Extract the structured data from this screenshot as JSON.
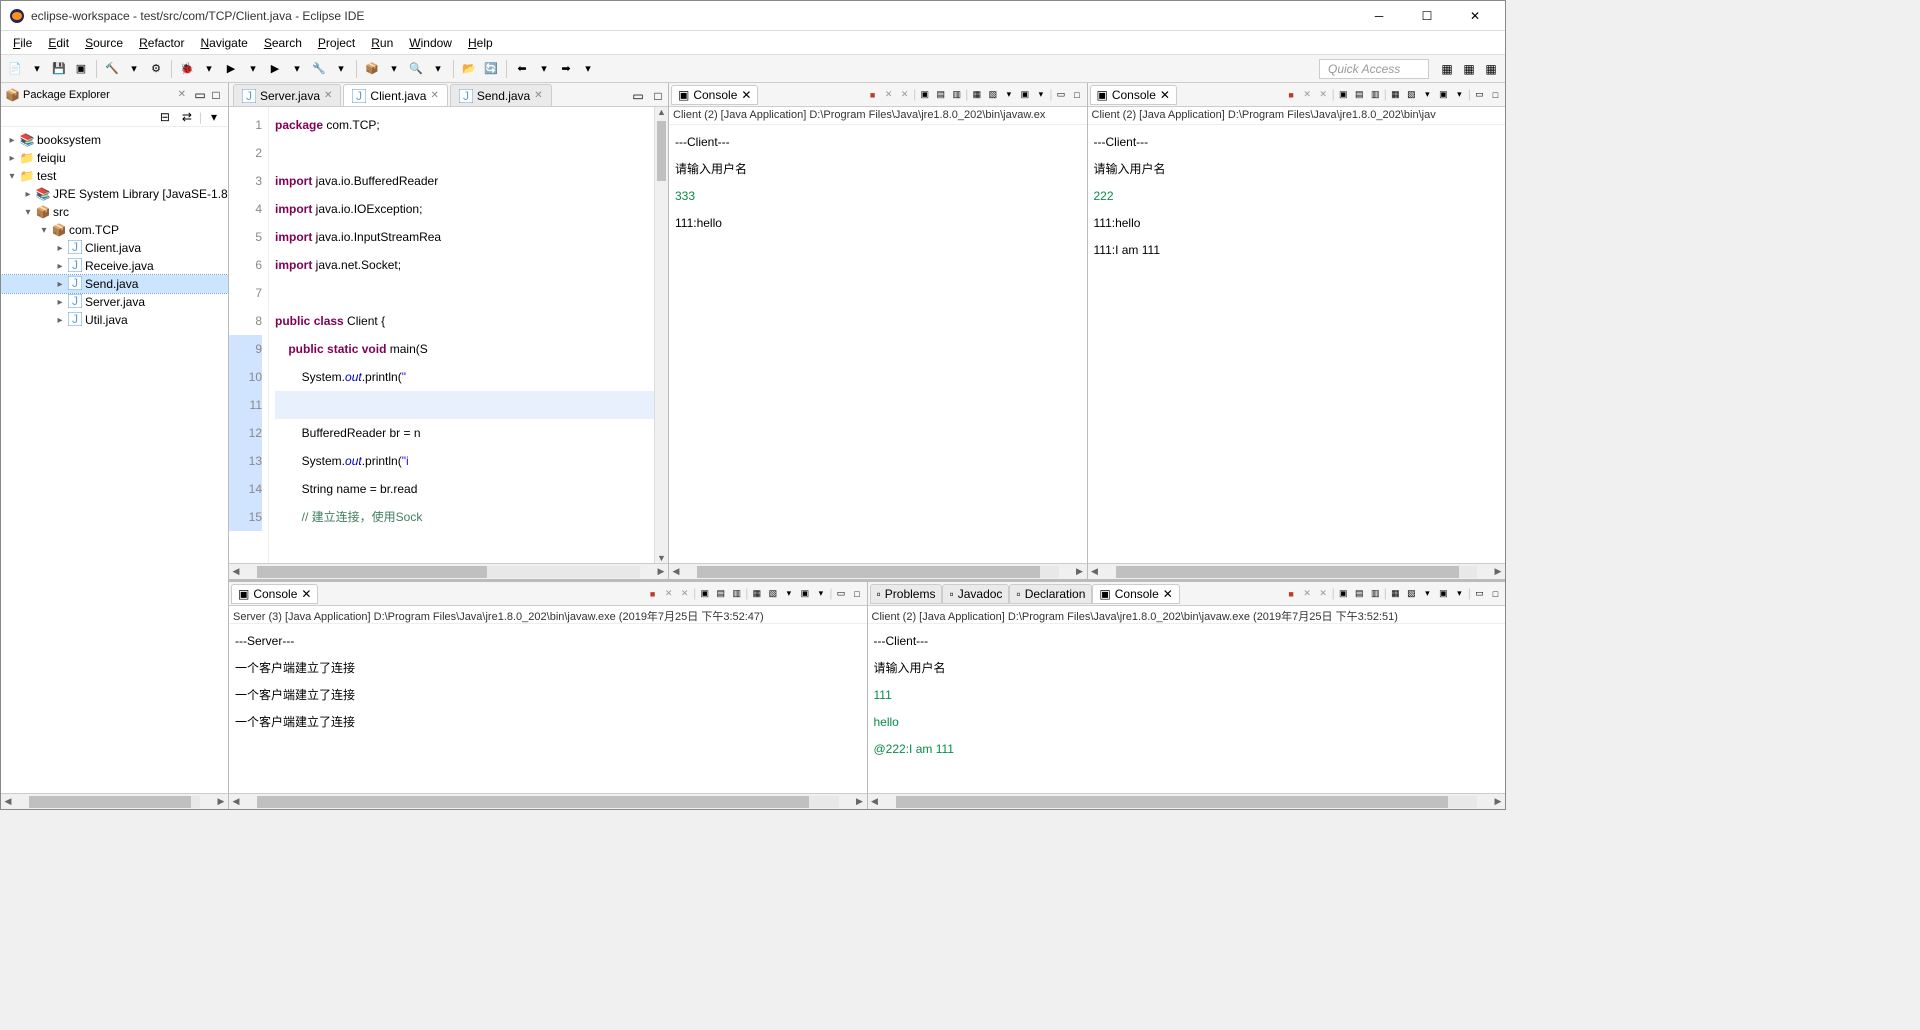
{
  "window": {
    "title": "eclipse-workspace - test/src/com/TCP/Client.java - Eclipse IDE"
  },
  "menu": [
    "File",
    "Edit",
    "Source",
    "Refactor",
    "Navigate",
    "Search",
    "Project",
    "Run",
    "Window",
    "Help"
  ],
  "quick_access": "Quick Access",
  "package_explorer": {
    "title": "Package Explorer",
    "tree": [
      {
        "d": 0,
        "tw": ">",
        "icon": "📚",
        "label": "booksystem"
      },
      {
        "d": 0,
        "tw": ">",
        "icon": "📁",
        "label": "feiqiu"
      },
      {
        "d": 0,
        "tw": "v",
        "icon": "📁",
        "label": "test"
      },
      {
        "d": 1,
        "tw": ">",
        "icon": "📚",
        "label": "JRE System Library [JavaSE-1.8"
      },
      {
        "d": 1,
        "tw": "v",
        "icon": "📦",
        "label": "src"
      },
      {
        "d": 2,
        "tw": "v",
        "icon": "📦",
        "label": "com.TCP"
      },
      {
        "d": 3,
        "tw": ">",
        "icon": "J",
        "label": "Client.java"
      },
      {
        "d": 3,
        "tw": ">",
        "icon": "J",
        "label": "Receive.java"
      },
      {
        "d": 3,
        "tw": ">",
        "icon": "J",
        "label": "Send.java",
        "sel": true
      },
      {
        "d": 3,
        "tw": ">",
        "icon": "J",
        "label": "Server.java"
      },
      {
        "d": 3,
        "tw": ">",
        "icon": "J",
        "label": "Util.java"
      }
    ]
  },
  "editor": {
    "tabs": [
      {
        "label": "Server.java"
      },
      {
        "label": "Client.java",
        "active": true
      },
      {
        "label": "Send.java"
      }
    ],
    "lines": [
      {
        "n": 1,
        "html": "<span class='kw'>package</span> com.TCP;"
      },
      {
        "n": 2,
        "html": ""
      },
      {
        "n": 3,
        "html": "<span class='kw'>import</span> java.io.BufferedReader"
      },
      {
        "n": 4,
        "html": "<span class='kw'>import</span> java.io.IOException;"
      },
      {
        "n": 5,
        "html": "<span class='kw'>import</span> java.io.InputStreamRea"
      },
      {
        "n": 6,
        "html": "<span class='kw'>import</span> java.net.Socket;"
      },
      {
        "n": 7,
        "html": ""
      },
      {
        "n": 8,
        "html": "<span class='kw'>public</span> <span class='kw'>class</span> Client {"
      },
      {
        "n": 9,
        "html": "    <span class='kw'>public</span> <span class='kw'>static</span> <span class='kw'>void</span> main(S",
        "mark": true
      },
      {
        "n": 10,
        "html": "        System.<span class='fld'>out</span>.println(<span class='str'>\"</span>",
        "mark": true
      },
      {
        "n": 11,
        "html": "",
        "mark": true,
        "hl": true
      },
      {
        "n": 12,
        "html": "        BufferedReader br = n",
        "mark": true
      },
      {
        "n": 13,
        "html": "        System.<span class='fld'>out</span>.println(<span class='str'>\"i</span>",
        "mark": true
      },
      {
        "n": 14,
        "html": "        String name = br.read",
        "mark": true
      },
      {
        "n": 15,
        "html": "        <span class='cmt'>// 建立连接，使用Sock</span>",
        "mark": true
      }
    ]
  },
  "consoles_top": [
    {
      "tab": "Console",
      "label": "Client (2) [Java Application] D:\\Program Files\\Java\\jre1.8.0_202\\bin\\javaw.ex",
      "lines": [
        {
          "t": "---Client---"
        },
        {
          "t": "请输入用户名"
        },
        {
          "t": "333",
          "c": "in"
        },
        {
          "t": "111:hello"
        }
      ]
    },
    {
      "tab": "Console",
      "label": "Client (2) [Java Application] D:\\Program Files\\Java\\jre1.8.0_202\\bin\\jav",
      "lines": [
        {
          "t": "---Client---"
        },
        {
          "t": "请输入用户名"
        },
        {
          "t": "222",
          "c": "in"
        },
        {
          "t": "111:hello"
        },
        {
          "t": "111:I am 111"
        }
      ]
    }
  ],
  "consoles_bottom": [
    {
      "tab": "Console",
      "label": "Server (3) [Java Application] D:\\Program Files\\Java\\jre1.8.0_202\\bin\\javaw.exe (2019年7月25日 下午3:52:47)",
      "lines": [
        {
          "t": "---Server---"
        },
        {
          "t": "一个客户端建立了连接"
        },
        {
          "t": "一个客户端建立了连接"
        },
        {
          "t": "一个客户端建立了连接"
        }
      ]
    },
    {
      "tabs_extra": [
        "Problems",
        "Javadoc",
        "Declaration"
      ],
      "tab": "Console",
      "label": "Client (2) [Java Application] D:\\Program Files\\Java\\jre1.8.0_202\\bin\\javaw.exe (2019年7月25日 下午3:52:51)",
      "lines": [
        {
          "t": "---Client---"
        },
        {
          "t": "请输入用户名"
        },
        {
          "t": "111",
          "c": "in"
        },
        {
          "t": "hello",
          "c": "in"
        },
        {
          "t": "@222:I am 111",
          "c": "in"
        }
      ]
    }
  ],
  "console_tool_icons": [
    "■",
    "✕",
    "✕",
    "│",
    "▣",
    "▤",
    "▥",
    "│",
    "▦",
    "▧",
    "▾",
    "▣",
    "▾",
    "│",
    "▭",
    "□"
  ],
  "toolbar_icons": [
    "📄",
    "▾",
    "💾",
    "▣",
    "│",
    "🔨",
    "▾",
    "⚙",
    "│",
    "🐞",
    "▾",
    "▶",
    "▾",
    "▶",
    "▾",
    "🔧",
    "▾",
    "│",
    "📦",
    "▾",
    "🔍",
    "▾",
    "│",
    "📂",
    "🔄",
    "│",
    "⬅",
    "▾",
    "➡",
    "▾"
  ]
}
